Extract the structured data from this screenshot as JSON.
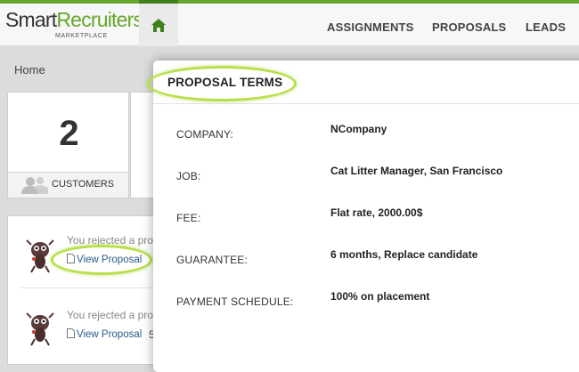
{
  "header": {
    "logo_main_a": "Smart",
    "logo_main_b": "Recruiters",
    "logo_sub": "MARKETPLACE",
    "nav": [
      "ASSIGNMENTS",
      "PROPOSALS",
      "LEADS"
    ]
  },
  "breadcrumb": "Home",
  "stats": {
    "customers_count": "2",
    "customers_label": "CUSTOMERS"
  },
  "activity": [
    {
      "text": "You rejected a propo",
      "link": "View Proposal"
    },
    {
      "text": "You rejected a propo",
      "link": "View Proposal",
      "extra": "5"
    }
  ],
  "modal": {
    "title": "PROPOSAL TERMS",
    "terms": [
      {
        "label": "COMPANY:",
        "value": "NCompany"
      },
      {
        "label": "JOB:",
        "value": "Cat Litter Manager, San Francisco"
      },
      {
        "label": "FEE:",
        "value": "Flat rate, 2000.00$"
      },
      {
        "label": "GUARANTEE:",
        "value": "6 months, Replace candidate"
      },
      {
        "label": "PAYMENT SCHEDULE:",
        "value": "100% on placement"
      }
    ]
  },
  "colors": {
    "brand_green": "#67a62c",
    "highlight": "#b8e04a",
    "link": "#2a5a8a"
  },
  "icons": [
    "home-icon",
    "people-icon",
    "avatar-icon",
    "document-icon"
  ]
}
